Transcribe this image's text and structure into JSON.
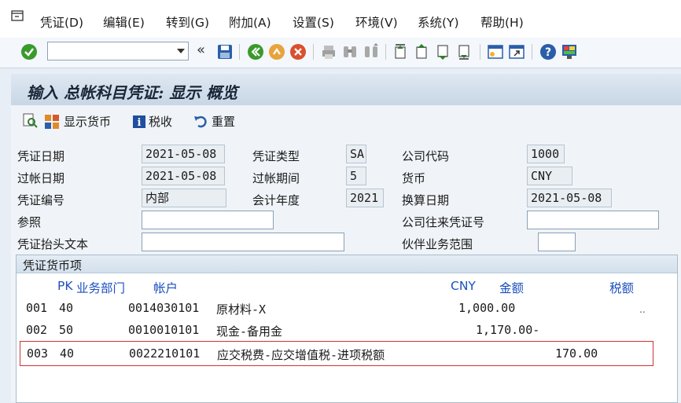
{
  "menu": {
    "items": [
      "凭证(D)",
      "编辑(E)",
      "转到(G)",
      "附加(A)",
      "设置(S)",
      "环境(V)",
      "系统(Y)",
      "帮助(H)"
    ]
  },
  "toolbar": {
    "command_value": "",
    "back_glyph": "«"
  },
  "title": "输入 总帐科目凭证: 显示 概览",
  "actions": {
    "display_currency": "显示货币",
    "tax": "税收",
    "reset": "重置"
  },
  "header": {
    "doc_date_label": "凭证日期",
    "doc_date": "2021-05-08",
    "posting_date_label": "过帐日期",
    "posting_date": "2021-05-08",
    "doc_number_label": "凭证编号",
    "doc_number": "内部",
    "reference_label": "参照",
    "reference": "",
    "header_text_label": "凭证抬头文本",
    "header_text": "",
    "doc_type_label": "凭证类型",
    "doc_type": "SA",
    "period_label": "过帐期间",
    "period": "5",
    "fiscal_year_label": "会计年度",
    "fiscal_year": "2021",
    "company_code_label": "公司代码",
    "company_code": "1000",
    "currency_label": "货币",
    "currency": "CNY",
    "translation_date_label": "换算日期",
    "translation_date": "2021-05-08",
    "intercompany_label": "公司往来凭证号",
    "intercompany": "",
    "trading_partner_label": "伙伴业务范围",
    "trading_partner": ""
  },
  "items_group": {
    "title": "凭证货币项",
    "col_pk": "PK",
    "col_bus_area": "业务部门",
    "col_account": "帐户",
    "col_currency": "CNY",
    "col_amount": "金额",
    "col_tax": "税额",
    "ellipsis": "..",
    "rows": [
      {
        "item": "001",
        "pk": "40",
        "account": "0014030101",
        "text": "原材料-X",
        "amount": "1,000.00"
      },
      {
        "item": "002",
        "pk": "50",
        "account": "0010010101",
        "text": "现金-备用金",
        "amount": "1,170.00-"
      },
      {
        "item": "003",
        "pk": "40",
        "account": "0022210101",
        "text": "应交税费-应交增值税-进项税额",
        "amount": "170.00"
      }
    ]
  },
  "colors": {
    "accent_blue": "#1c4fbf",
    "highlight_red": "#d13232",
    "ok_green": "#3a9a2c",
    "cancel_red": "#d9502e"
  }
}
